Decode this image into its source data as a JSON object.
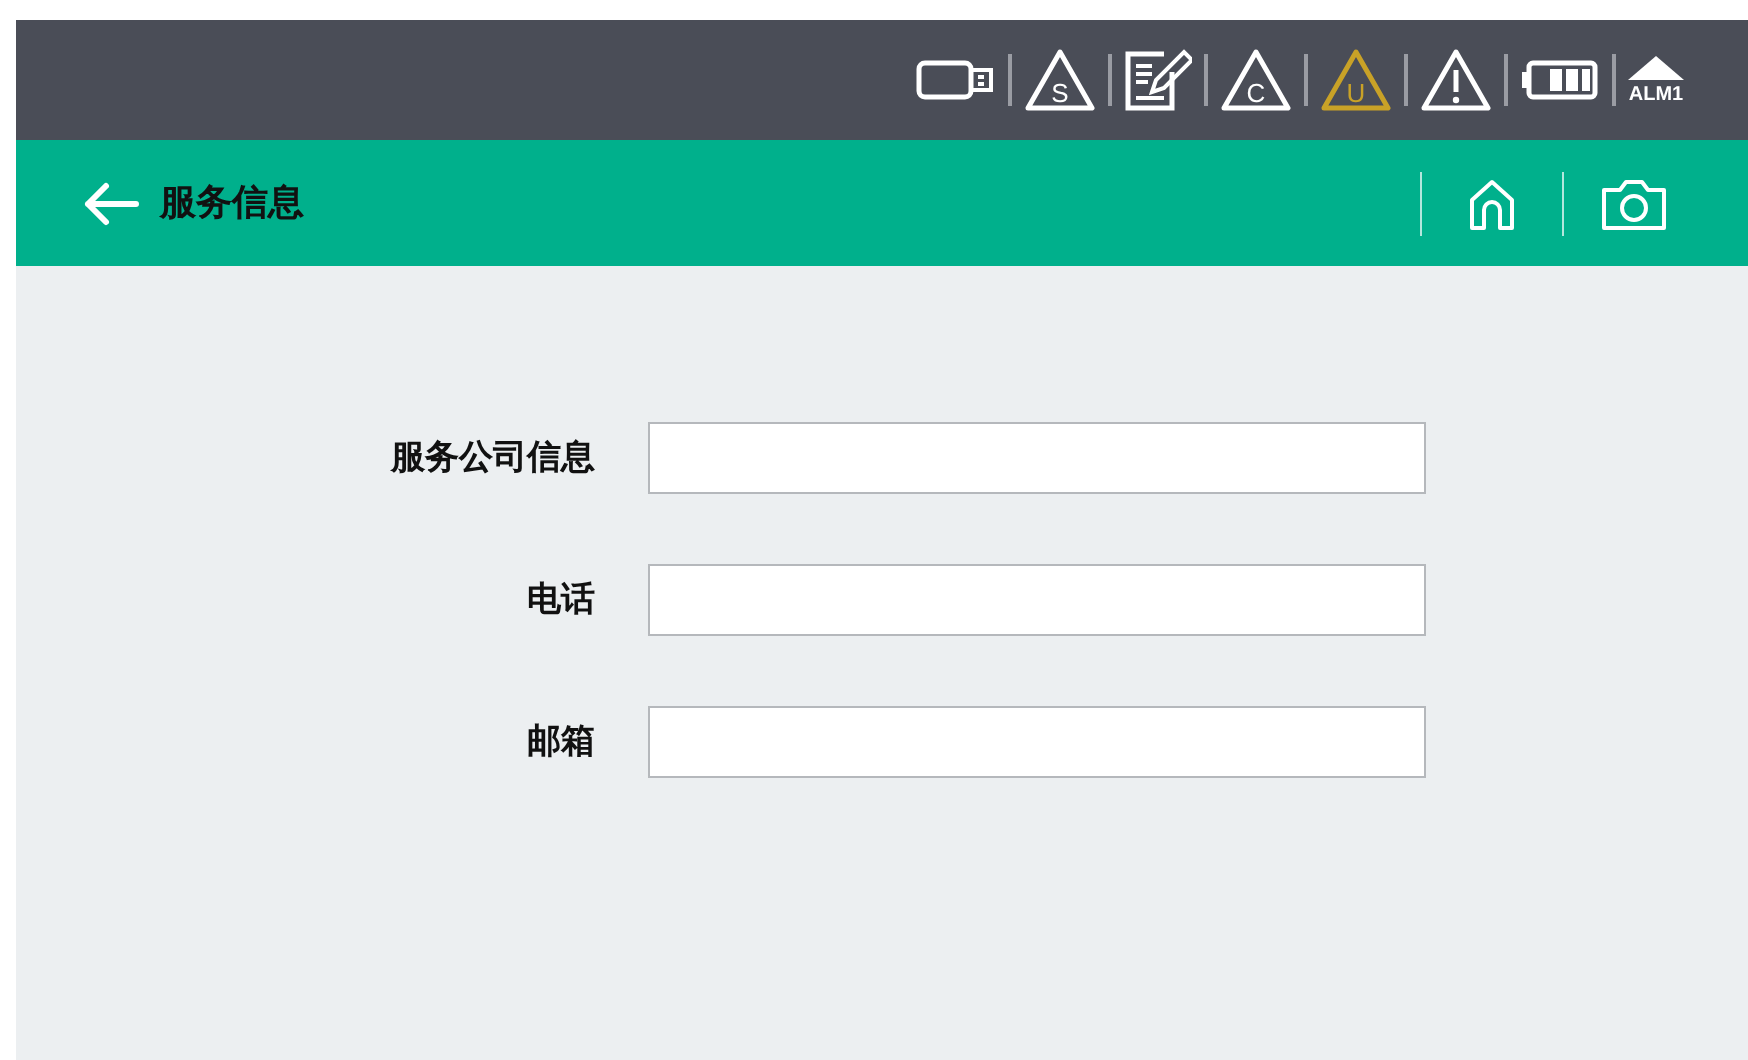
{
  "status_icons": [
    {
      "kind": "usb",
      "color": "#ffffff"
    },
    {
      "kind": "triangle",
      "letter": "S",
      "color": "#ffffff"
    },
    {
      "kind": "note",
      "color": "#ffffff"
    },
    {
      "kind": "triangle",
      "letter": "C",
      "color": "#ffffff"
    },
    {
      "kind": "triangle",
      "letter": "U",
      "color": "#c9a227"
    },
    {
      "kind": "alert",
      "color": "#ffffff"
    },
    {
      "kind": "battery",
      "color": "#ffffff"
    },
    {
      "kind": "alarm",
      "label": "ALM1",
      "color": "#ffffff"
    }
  ],
  "header": {
    "title": "服务信息"
  },
  "form": {
    "fields": [
      {
        "label": "服务公司信息"
      },
      {
        "label": "电话"
      },
      {
        "label": "邮箱"
      }
    ]
  }
}
